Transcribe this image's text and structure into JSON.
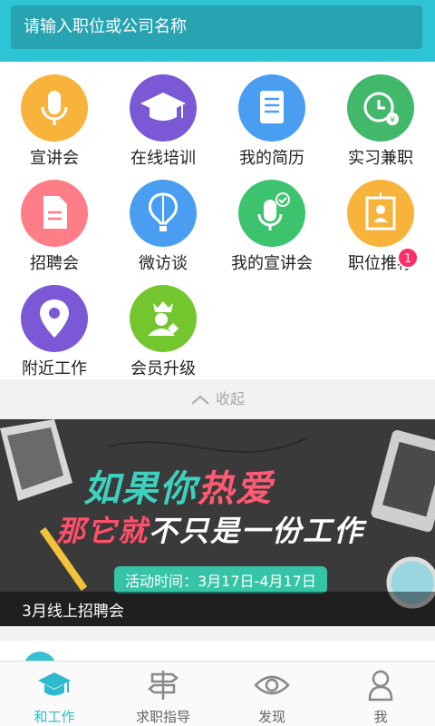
{
  "search": {
    "placeholder": "请输入职位或公司名称"
  },
  "colors": {
    "header": "#2fc3d6",
    "accent": "#2fb9cf",
    "badge": "#ff2d6a"
  },
  "grid": {
    "items": [
      {
        "label": "宣讲会",
        "icon": "microphone-icon",
        "color": "#f8b33a"
      },
      {
        "label": "在线培训",
        "icon": "graduation-cap-icon",
        "color": "#7b58d6"
      },
      {
        "label": "我的简历",
        "icon": "document-icon",
        "color": "#4a9ef2"
      },
      {
        "label": "实习兼职",
        "icon": "clock-money-icon",
        "color": "#41b86a"
      },
      {
        "label": "招聘会",
        "icon": "file-icon",
        "color": "#ff7d86"
      },
      {
        "label": "微访谈",
        "icon": "balloon-icon",
        "color": "#4a9ef2"
      },
      {
        "label": "我的宣讲会",
        "icon": "microphone-check-icon",
        "color": "#3dc36e"
      },
      {
        "label": "职位推荐",
        "icon": "portrait-frame-icon",
        "color": "#f8b33a"
      },
      {
        "label": "附近工作",
        "icon": "location-pin-icon",
        "color": "#7b58d6"
      },
      {
        "label": "会员升级",
        "icon": "crown-user-icon",
        "color": "#74c62f"
      }
    ],
    "badge": "1"
  },
  "collapse": {
    "label": "收起"
  },
  "banner": {
    "line1_a": "如果你",
    "line1_b": "热爱",
    "line2_a": "那它就",
    "line2_b": "不只是一份工作",
    "date": "活动时间：3月17日-4月17日",
    "caption": "3月线上招聘会"
  },
  "tabs": [
    {
      "label": "和工作",
      "icon": "graduation-cap-icon",
      "active": true
    },
    {
      "label": "求职指导",
      "icon": "signpost-icon",
      "active": false
    },
    {
      "label": "发现",
      "icon": "eye-icon",
      "active": false
    },
    {
      "label": "我",
      "icon": "person-icon",
      "active": false
    }
  ]
}
